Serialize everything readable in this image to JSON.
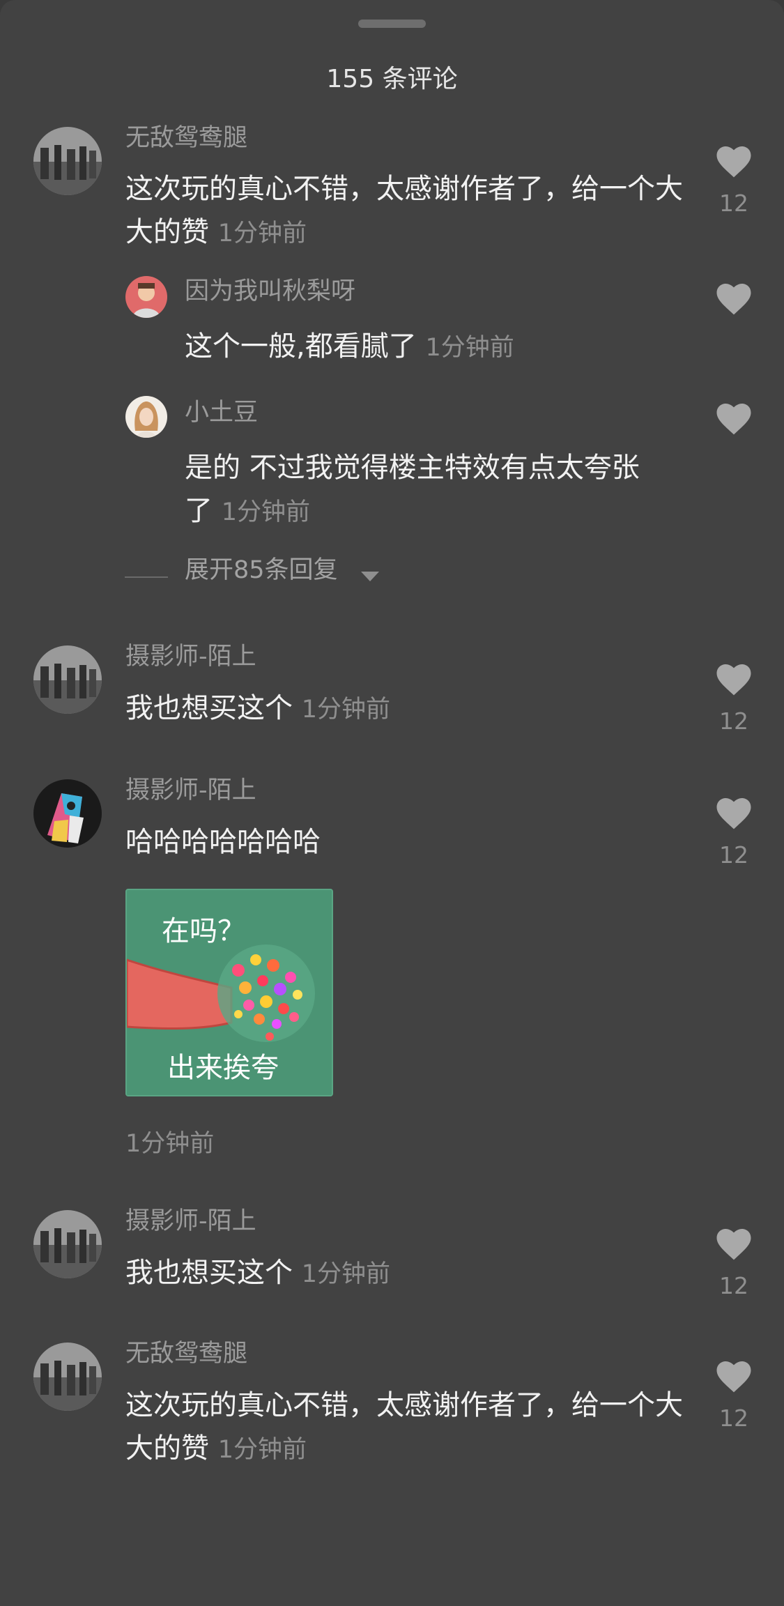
{
  "header": {
    "title": "155 条评论"
  },
  "comments": [
    {
      "name": "无敌鸳鸯腿",
      "text": "这次玩的真心不错，太感谢作者了，给一个大大的赞",
      "time": "1分钟前",
      "likes": "12"
    },
    {
      "name": "因为我叫秋梨呀",
      "text": "这个一般,都看腻了",
      "time": "1分钟前"
    },
    {
      "name": "小土豆",
      "text": "是的 不过我觉得楼主特效有点太夸张了",
      "time": "1分钟前"
    },
    {
      "name": "摄影师-陌上",
      "text": "我也想买这个",
      "time": "1分钟前",
      "likes": "12"
    },
    {
      "name": "摄影师-陌上",
      "text": "哈哈哈哈哈哈哈",
      "time": "1分钟前",
      "likes": "12"
    },
    {
      "name": "摄影师-陌上",
      "text": "我也想买这个",
      "time": "1分钟前",
      "likes": "12"
    },
    {
      "name": "无敌鸳鸯腿",
      "text": "这次玩的真心不错，太感谢作者了，给一个大大的赞",
      "time": "1分钟前",
      "likes": "12"
    }
  ],
  "replies": {
    "expand_label": "展开85条回复"
  },
  "sticker": {
    "line1": "在吗？",
    "line2": "出来挨夸"
  },
  "colors": {
    "background": "#424242",
    "like": "#a9a9a9",
    "text": "#f2f2f2",
    "muted": "#8f8f8f"
  }
}
